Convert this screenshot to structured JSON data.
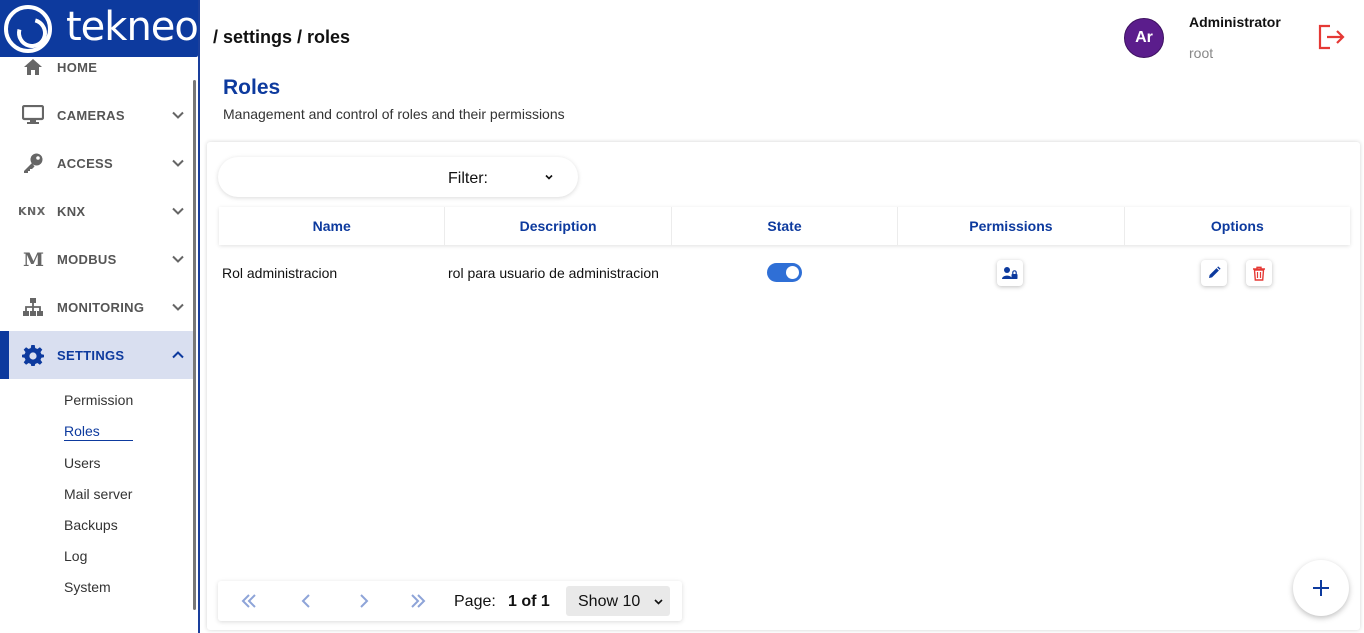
{
  "brand": {
    "name": "tekneo",
    "color": "#0d3a9e"
  },
  "sidebar": {
    "items": [
      {
        "label": "HOME",
        "icon": "home-icon"
      },
      {
        "label": "CAMERAS",
        "icon": "monitor-icon"
      },
      {
        "label": "ACCESS",
        "icon": "key-icon"
      },
      {
        "label": "KNX",
        "icon": "knx-icon"
      },
      {
        "label": "MODBUS",
        "icon": "modbus-icon"
      },
      {
        "label": "MONITORING",
        "icon": "sitemap-icon"
      },
      {
        "label": "SETTINGS",
        "icon": "gear-icon",
        "active": true
      }
    ],
    "settings_submenu": [
      "Permission",
      "Roles",
      "Users",
      "Mail server",
      "Backups",
      "Log",
      "System"
    ],
    "active_submenu": "Roles"
  },
  "header": {
    "breadcrumb": "/ settings / roles",
    "user": {
      "initials": "Ar",
      "name": "Administrator",
      "role": "root",
      "avatar_color": "#5b1d8c"
    },
    "logout_icon": "logout-icon",
    "logout_color": "#e53935"
  },
  "page": {
    "title": "Roles",
    "subtitle": "Management and control of roles and their permissions"
  },
  "filter": {
    "label": "Filter:"
  },
  "table": {
    "columns": [
      "Name",
      "Description",
      "State",
      "Permissions",
      "Options"
    ],
    "rows": [
      {
        "name": "Rol administracion",
        "description": "rol para usuario de administracion",
        "state": true
      }
    ]
  },
  "pagination": {
    "page_label": "Page:",
    "page_value": "1 of 1",
    "show_value": "Show 10"
  },
  "accent_color": "#2f6fd6",
  "delete_color": "#e53935"
}
